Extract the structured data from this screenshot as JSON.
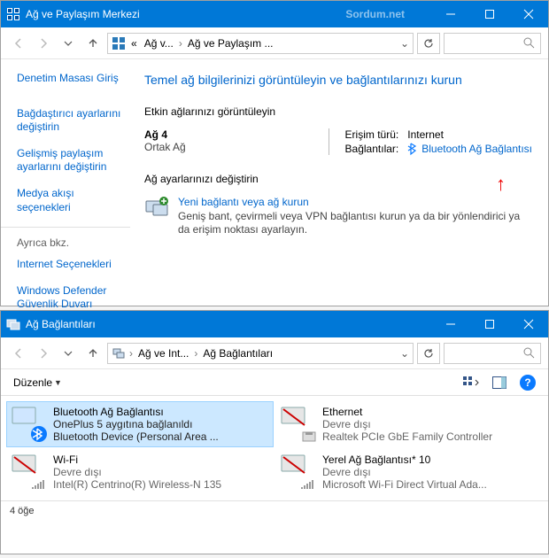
{
  "win1": {
    "title": "Ağ ve Paylaşım Merkezi",
    "watermark": "Sordum.net",
    "breadcrumb": {
      "pre": "«",
      "item1": "Ağ v...",
      "item2": "Ağ ve Paylaşım ..."
    },
    "sidebar": {
      "cp_home": "Denetim Masası Giriş",
      "adapter": "Bağdaştırıcı ayarlarını değiştirin",
      "sharing": "Gelişmiş paylaşım ayarlarını değiştirin",
      "media": "Medya akışı seçenekleri",
      "also": "Ayrıca bkz.",
      "inetopt": "Internet Seçenekleri",
      "wdfw": "Windows Defender Güvenlik Duvarı"
    },
    "heading": "Temel ağ bilgilerinizi görüntüleyin ve bağlantılarınızı kurun",
    "active_label": "Etkin ağlarınızı görüntüleyin",
    "network": {
      "name": "Ağ 4",
      "type": "Ortak Ağ"
    },
    "access": {
      "label": "Erişim türü:",
      "value": "Internet"
    },
    "conn": {
      "label": "Bağlantılar:",
      "link": "Bluetooth Ağ Bağlantısı"
    },
    "change_label": "Ağ ayarlarınızı değiştirin",
    "newconn": {
      "link": "Yeni bağlantı veya ağ kurun",
      "desc": "Geniş bant, çevirmeli veya VPN bağlantısı kurun ya da bir yönlendirici ya da erişim noktası ayarlayın."
    }
  },
  "win2": {
    "title": "Ağ Bağlantıları",
    "breadcrumb": {
      "item1": "Ağ ve Int...",
      "item2": "Ağ Bağlantıları"
    },
    "toolbar": {
      "organize": "Düzenle"
    },
    "adapters": [
      {
        "name": "Bluetooth Ağ Bağlantısı",
        "line1": "OnePlus 5 aygıtına bağlanıldı",
        "line2": "Bluetooth Device (Personal Area ...",
        "selected": true,
        "kind": "bt"
      },
      {
        "name": "Ethernet",
        "line1": "Devre dışı",
        "line2": "Realtek PCIe GbE Family Controller",
        "selected": false,
        "kind": "eth"
      },
      {
        "name": "Wi-Fi",
        "line1": "Devre dışı",
        "line2": "Intel(R) Centrino(R) Wireless-N 135",
        "selected": false,
        "kind": "wifi"
      },
      {
        "name": "Yerel Ağ Bağlantısı* 10",
        "line1": "Devre dışı",
        "line2": "Microsoft Wi-Fi Direct Virtual Ada...",
        "selected": false,
        "kind": "wifi"
      }
    ],
    "status": "4 öğe"
  }
}
